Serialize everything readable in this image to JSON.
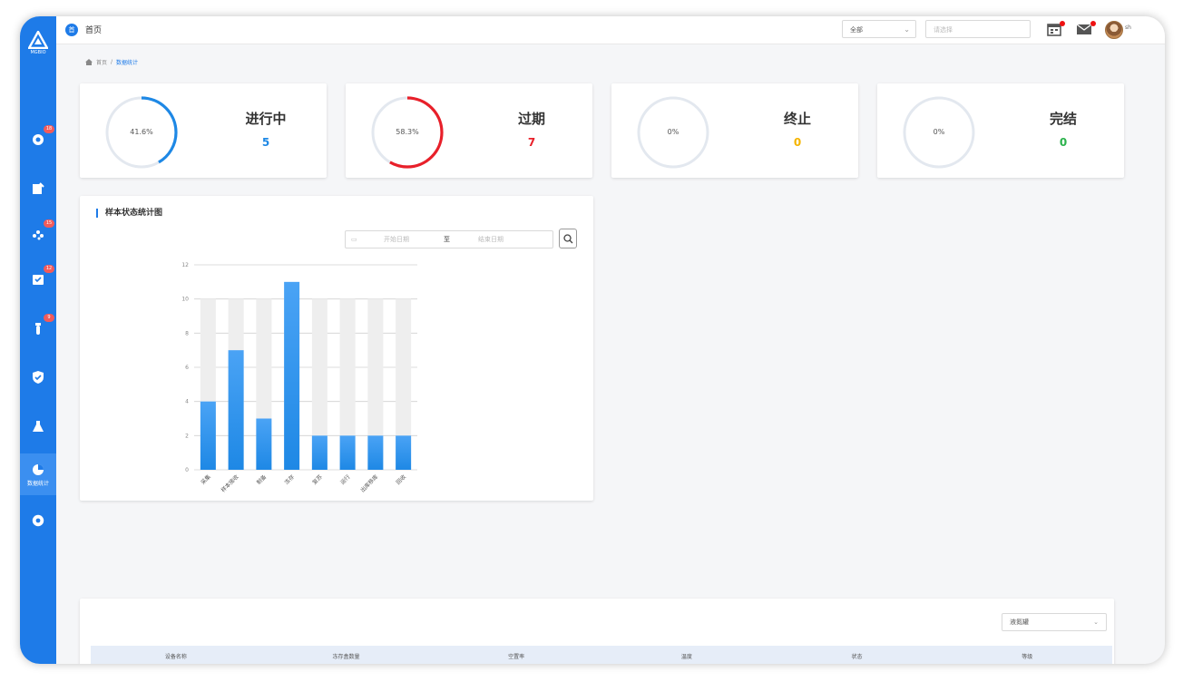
{
  "app": {
    "logo_text": "MGBIO"
  },
  "topbar": {
    "home_glyph": "首",
    "tab_title": "首页",
    "scope_select": "全部",
    "search_placeholder": "请选择",
    "user_name": "sh"
  },
  "sidebar": {
    "items": [
      {
        "icon": "gear-shield-icon",
        "badge": "18"
      },
      {
        "icon": "edit-doc-icon",
        "badge": ""
      },
      {
        "icon": "molecule-icon",
        "badge": "15"
      },
      {
        "icon": "check-box-icon",
        "badge": "12"
      },
      {
        "icon": "tube-icon",
        "badge": "9"
      },
      {
        "icon": "shield-check-icon",
        "badge": ""
      },
      {
        "icon": "flask-icon",
        "badge": ""
      },
      {
        "icon": "pie-chart-icon",
        "badge": "",
        "label": "数据统计",
        "active": true
      },
      {
        "icon": "settings-icon",
        "badge": ""
      }
    ]
  },
  "breadcrumb": {
    "home": "首页",
    "separator": "/",
    "current": "数据统计"
  },
  "stats": [
    {
      "label": "进行中",
      "value": "5",
      "percent_text": "41.6%",
      "percent": 41.6,
      "color": "#1e88e5"
    },
    {
      "label": "过期",
      "value": "7",
      "percent_text": "58.3%",
      "percent": 58.3,
      "color": "#e8202a"
    },
    {
      "label": "终止",
      "value": "0",
      "percent_text": "0%",
      "percent": 0,
      "color": "#f5b400"
    },
    {
      "label": "完结",
      "value": "0",
      "percent_text": "0%",
      "percent": 0,
      "color": "#2bb24c"
    }
  ],
  "chart_panel": {
    "title": "样本状态统计图",
    "start_placeholder": "开始日期",
    "to_text": "至",
    "end_placeholder": "结束日期"
  },
  "chart_data": {
    "type": "bar",
    "categories": [
      "采集",
      "样本接收",
      "制备",
      "冻存",
      "复苏",
      "运行",
      "出库移库",
      "回收"
    ],
    "values": [
      4,
      7,
      3,
      11,
      2,
      2,
      2,
      2
    ],
    "background_values": [
      10,
      10,
      10,
      10,
      10,
      10,
      10,
      10
    ],
    "ylim": [
      0,
      12
    ],
    "yticks": [
      0,
      2,
      4,
      6,
      8,
      10,
      12
    ],
    "grid": true,
    "bar_color": "#1e88e5",
    "title": "",
    "xlabel": "",
    "ylabel": ""
  },
  "table": {
    "filter_select": "液氮罐",
    "columns": [
      "设备名称",
      "冻存盒数量",
      "空置率",
      "温度",
      "状态",
      "等级"
    ]
  }
}
